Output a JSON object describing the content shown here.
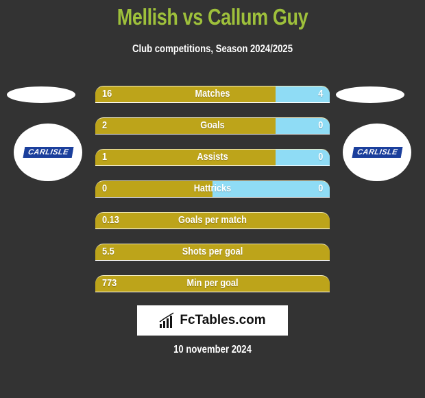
{
  "header": {
    "title": "Mellish vs Callum Guy",
    "subtitle": "Club competitions, Season 2024/2025"
  },
  "teams": {
    "left": {
      "logo_text": "CARLISLE"
    },
    "right": {
      "logo_text": "CARLISLE"
    }
  },
  "colors": {
    "left": "#bda41a",
    "right": "#8fdcf5",
    "title": "#9ec03b"
  },
  "stats": [
    {
      "label": "Matches",
      "left": "16",
      "right": "4",
      "left_fraction": 0.77
    },
    {
      "label": "Goals",
      "left": "2",
      "right": "0",
      "left_fraction": 0.77
    },
    {
      "label": "Assists",
      "left": "1",
      "right": "0",
      "left_fraction": 0.77
    },
    {
      "label": "Hattricks",
      "left": "0",
      "right": "0",
      "left_fraction": 0.5
    },
    {
      "label": "Goals per match",
      "left": "0.13",
      "right": "",
      "left_fraction": 1
    },
    {
      "label": "Shots per goal",
      "left": "5.5",
      "right": "",
      "left_fraction": 1
    },
    {
      "label": "Min per goal",
      "left": "773",
      "right": "",
      "left_fraction": 1
    }
  ],
  "brand": {
    "name": "FcTables.com",
    "icon": "bar-chart-icon"
  },
  "footer": {
    "date": "10 november 2024"
  }
}
